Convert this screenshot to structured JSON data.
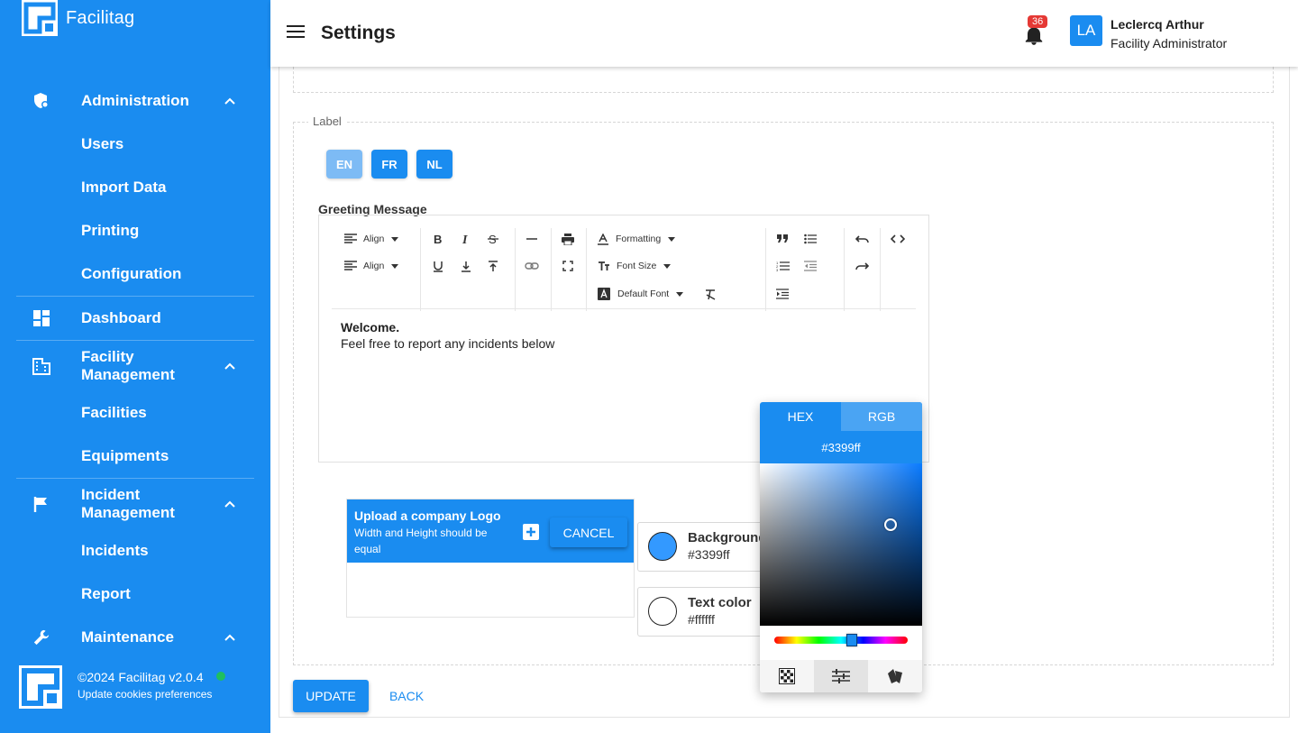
{
  "brand": {
    "name": "Facilitag"
  },
  "header": {
    "title": "Settings",
    "notifications_count": "36",
    "user_initials": "LA",
    "user_name": "Leclercq Arthur",
    "user_role": "Facility Administrator"
  },
  "sidebar": {
    "groups": [
      {
        "label": "Administration",
        "icon": "shield-gear-icon",
        "items": [
          "Users",
          "Import Data",
          "Printing",
          "Configuration"
        ]
      },
      {
        "label": "Dashboard",
        "icon": "dashboard-icon",
        "items": []
      },
      {
        "label": "Facility Management",
        "icon": "building-icon",
        "items": [
          "Facilities",
          "Equipments"
        ]
      },
      {
        "label": "Incident Management",
        "icon": "flag-icon",
        "items": [
          "Incidents",
          "Report"
        ]
      },
      {
        "label": "Maintenance",
        "icon": "wrench-icon",
        "items": []
      }
    ],
    "footer": {
      "copyright": "©2024 Facilitag  v2.0.4",
      "cookies_link": "Update cookies preferences",
      "status_color": "#1fbf5f"
    }
  },
  "form": {
    "section_label": "Label",
    "languages": [
      "EN",
      "FR",
      "NL"
    ],
    "active_language": "EN",
    "greeting_label": "Greeting Message",
    "toolbar": {
      "align_1": "Align",
      "align_2": "Align",
      "formatting": "Formatting",
      "font_size": "Font Size",
      "default_font": "Default Font"
    },
    "editor_text": {
      "line1": "Welcome.",
      "line2": "Feel free to report any incidents below"
    },
    "upload": {
      "title": "Upload a company Logo",
      "hint": "Width and Height should be equal",
      "cancel_label": "CANCEL"
    },
    "background": {
      "label": "Background",
      "value": "#3399ff"
    },
    "text_color": {
      "label": "Text color",
      "value": "#ffffff"
    },
    "update_label": "UPDATE",
    "back_label": "BACK"
  },
  "color_picker": {
    "tab_hex": "HEX",
    "tab_rgb": "RGB",
    "value": "#3399ff",
    "modes": [
      "checkerboard-icon",
      "sliders-icon",
      "palette-icon"
    ]
  },
  "colors": {
    "primary": "#1a8cf0",
    "badge": "#e53935"
  }
}
